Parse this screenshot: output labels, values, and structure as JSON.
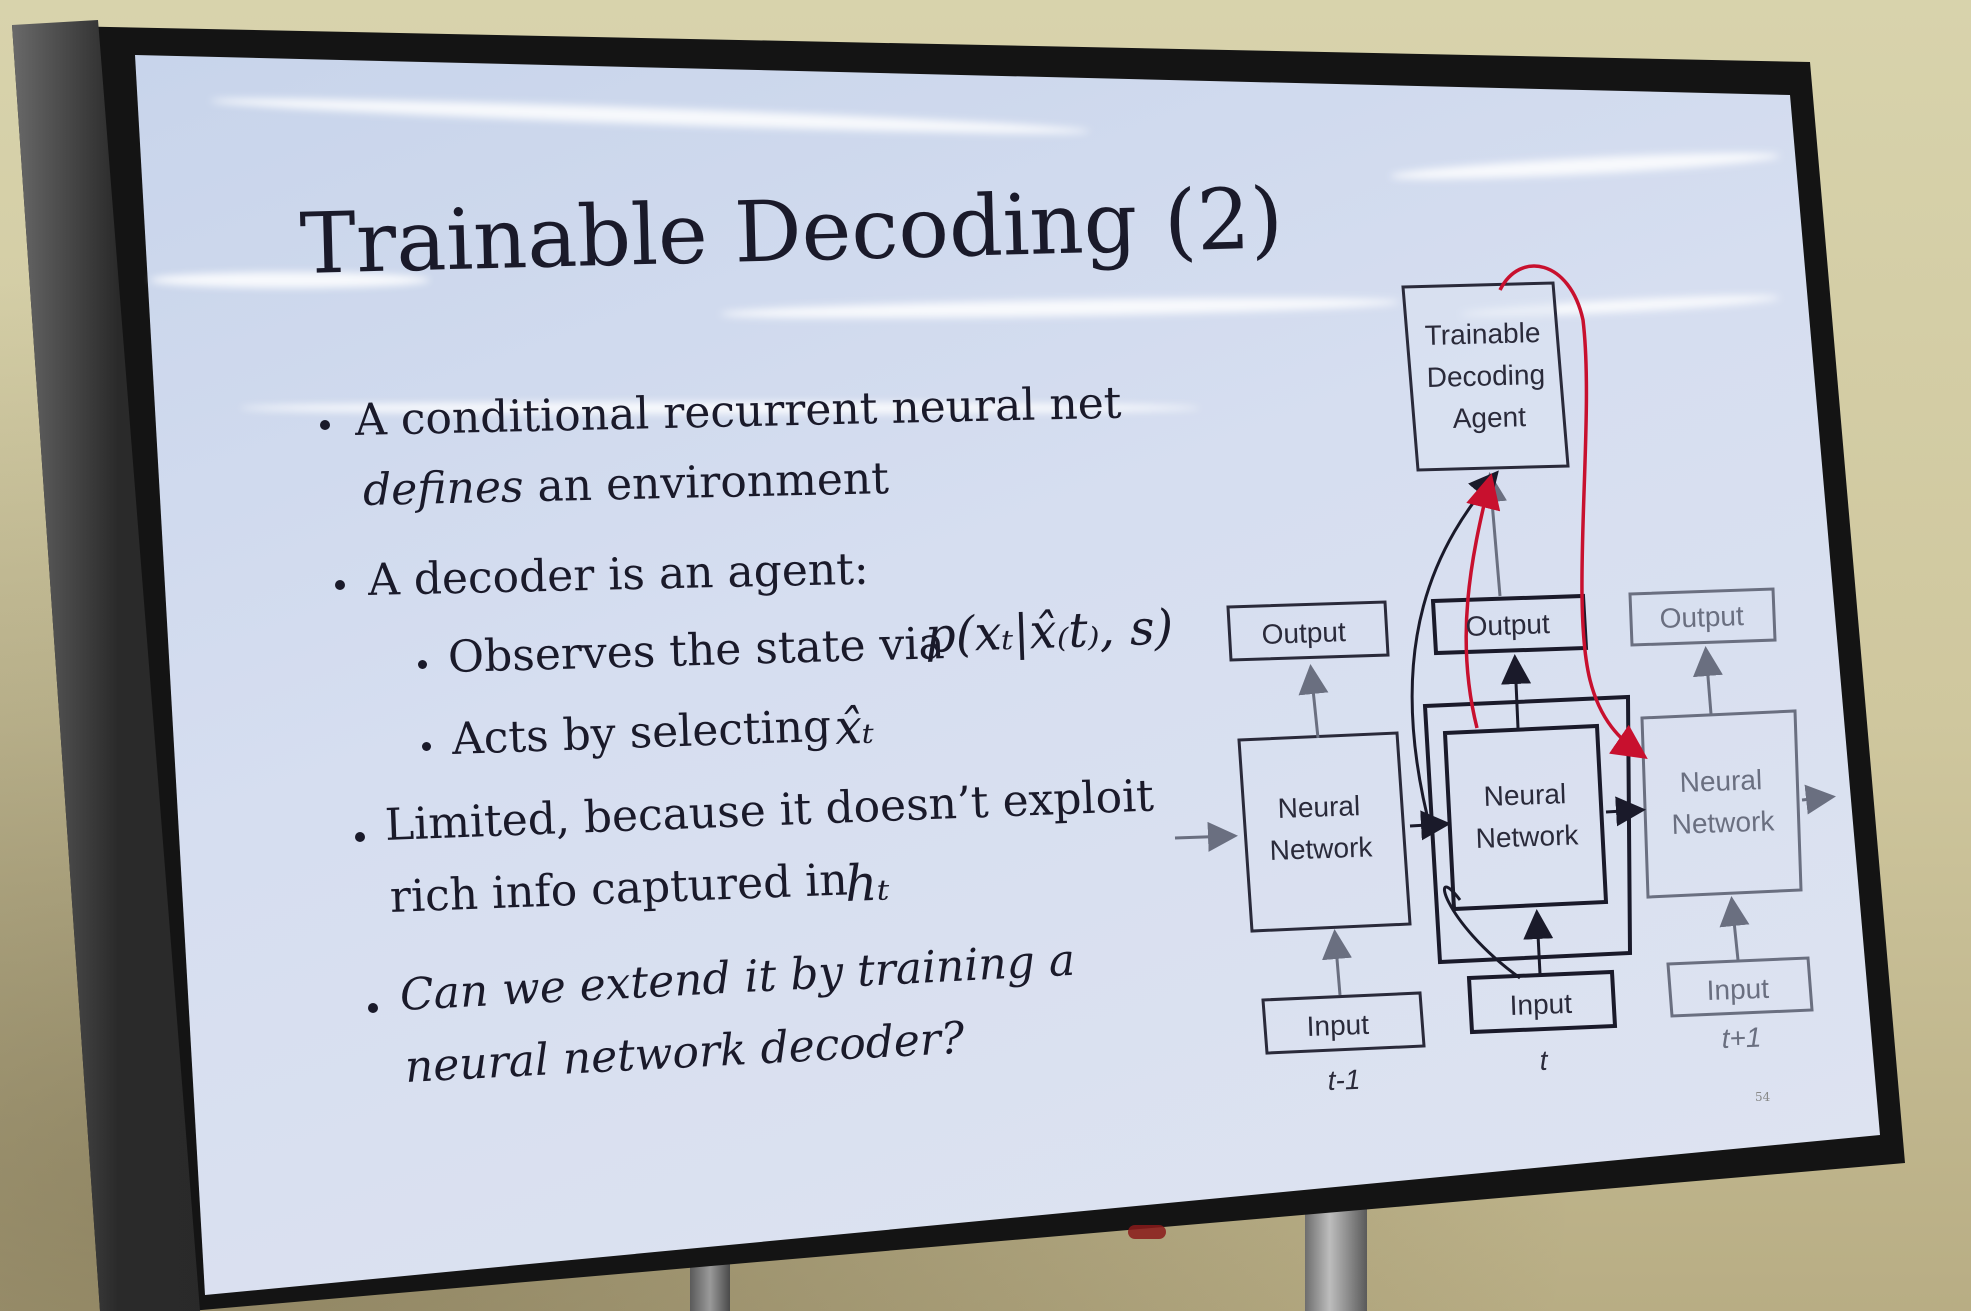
{
  "slide": {
    "title": "Trainable Decoding (2)",
    "bullets": [
      {
        "line1": "A conditional recurrent neural net",
        "line2_italic": "defines",
        "line2_rest": " an environment"
      },
      {
        "line1": "A decoder is an agent:"
      },
      {
        "sub": "Observes the state via",
        "math": "p(xₜ|x̂₍t₎, s)"
      },
      {
        "sub": "Acts by selecting",
        "math": "x̂ₜ"
      },
      {
        "line1": "Limited, because it doesn’t exploit",
        "line2": "rich info captured in",
        "math": "hₜ"
      },
      {
        "line1": "Can we extend it by training a",
        "line2": "neural network decoder?"
      }
    ],
    "page_number": "54"
  },
  "diagram": {
    "agent_line1": "Trainable",
    "agent_line2": "Decoding",
    "agent_line3": "Agent",
    "columns": [
      {
        "output": "Output",
        "nn_line1": "Neural",
        "nn_line2": "Network",
        "input": "Input",
        "time": "t-1"
      },
      {
        "output": "Output",
        "nn_line1": "Neural",
        "nn_line2": "Network",
        "input": "Input",
        "time": "t"
      },
      {
        "output": "Output",
        "nn_line1": "Neural",
        "nn_line2": "Network",
        "input": "Input",
        "time": "t+1"
      }
    ],
    "colors": {
      "red_arrow": "#c8102e",
      "box_stroke": "#2a2a3a",
      "faded_stroke": "#6a6f80"
    }
  }
}
